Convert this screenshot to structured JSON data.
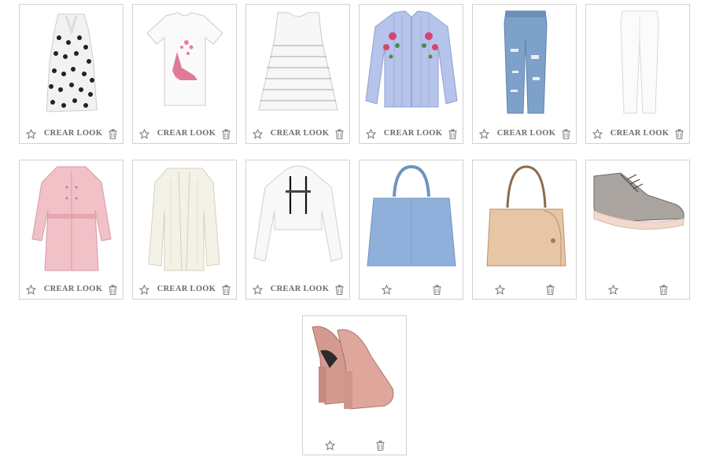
{
  "actions": {
    "create_look": "CREAR LOOK"
  },
  "items": [
    {
      "id": "polka-dot-dress",
      "has_look": true
    },
    {
      "id": "white-shoe-print-tee",
      "has_look": true
    },
    {
      "id": "white-striped-top",
      "has_look": true
    },
    {
      "id": "embroidered-striped-shirt",
      "has_look": true
    },
    {
      "id": "ripped-blue-jeans",
      "has_look": true
    },
    {
      "id": "white-skinny-jeans",
      "has_look": true
    },
    {
      "id": "pink-trench-coat",
      "has_look": true
    },
    {
      "id": "cream-knit-cardigan",
      "has_look": true
    },
    {
      "id": "white-cropped-hoodie",
      "has_look": true
    },
    {
      "id": "blue-handbag",
      "has_look": false
    },
    {
      "id": "tan-handbag",
      "has_look": false
    },
    {
      "id": "metallic-brogues",
      "has_look": false
    },
    {
      "id": "nude-platform-pumps",
      "has_look": false
    }
  ]
}
